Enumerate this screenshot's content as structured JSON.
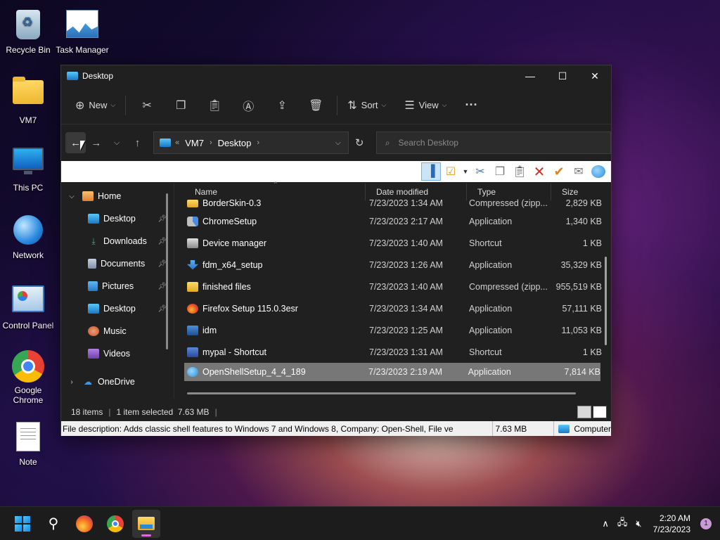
{
  "desktop": {
    "icons": [
      {
        "label": "Recycle Bin"
      },
      {
        "label": "Task Manager"
      },
      {
        "label": "VM7"
      },
      {
        "label": "This PC"
      },
      {
        "label": "Network"
      },
      {
        "label": "Control Panel"
      },
      {
        "label": "Google Chrome"
      },
      {
        "label": "Note"
      }
    ]
  },
  "window": {
    "title": "Desktop",
    "controls": {
      "minimize": "—",
      "maximize": "☐",
      "close": "✕"
    }
  },
  "commandbar": {
    "new_label": "New",
    "sort_label": "Sort",
    "view_label": "View",
    "more_label": "···"
  },
  "navbar": {
    "breadcrumb": [
      "VM7",
      "Desktop"
    ],
    "search_placeholder": "Search Desktop"
  },
  "navpane": {
    "items": [
      {
        "label": "Home"
      },
      {
        "label": "Desktop"
      },
      {
        "label": "Downloads"
      },
      {
        "label": "Documents"
      },
      {
        "label": "Pictures"
      },
      {
        "label": "Desktop"
      },
      {
        "label": "Music"
      },
      {
        "label": "Videos"
      },
      {
        "label": "OneDrive"
      }
    ]
  },
  "filelist": {
    "columns": [
      "Name",
      "Date modified",
      "Type",
      "Size"
    ],
    "rows": [
      {
        "name": "BorderSkin-0.3",
        "date": "7/23/2023 1:34 AM",
        "type": "Compressed (zipp...",
        "size": "2,829 KB"
      },
      {
        "name": "ChromeSetup",
        "date": "7/23/2023 2:17 AM",
        "type": "Application",
        "size": "1,340 KB"
      },
      {
        "name": "Device manager",
        "date": "7/23/2023 1:40 AM",
        "type": "Shortcut",
        "size": "1 KB"
      },
      {
        "name": "fdm_x64_setup",
        "date": "7/23/2023 1:26 AM",
        "type": "Application",
        "size": "35,329 KB"
      },
      {
        "name": "finished files",
        "date": "7/23/2023 1:40 AM",
        "type": "Compressed (zipp...",
        "size": "955,519 KB"
      },
      {
        "name": "Firefox Setup 115.0.3esr",
        "date": "7/23/2023 1:34 AM",
        "type": "Application",
        "size": "57,111 KB"
      },
      {
        "name": "idm",
        "date": "7/23/2023 1:25 AM",
        "type": "Application",
        "size": "11,053 KB"
      },
      {
        "name": "mypal - Shortcut",
        "date": "7/23/2023 1:31 AM",
        "type": "Shortcut",
        "size": "1 KB"
      },
      {
        "name": "OpenShellSetup_4_4_189",
        "date": "7/23/2023 2:19 AM",
        "type": "Application",
        "size": "7,814 KB"
      }
    ]
  },
  "statusbar": {
    "count": "18 items",
    "selection": "1 item selected  7.63 MB"
  },
  "infobar": {
    "description": "File description: Adds classic shell features to Windows 7 and Windows 8, Company: Open-Shell, File ve",
    "size": "7.63 MB",
    "location": "Computer"
  },
  "taskbar": {
    "time": "2:20 AM",
    "date": "7/23/2023",
    "notifications": "1"
  }
}
